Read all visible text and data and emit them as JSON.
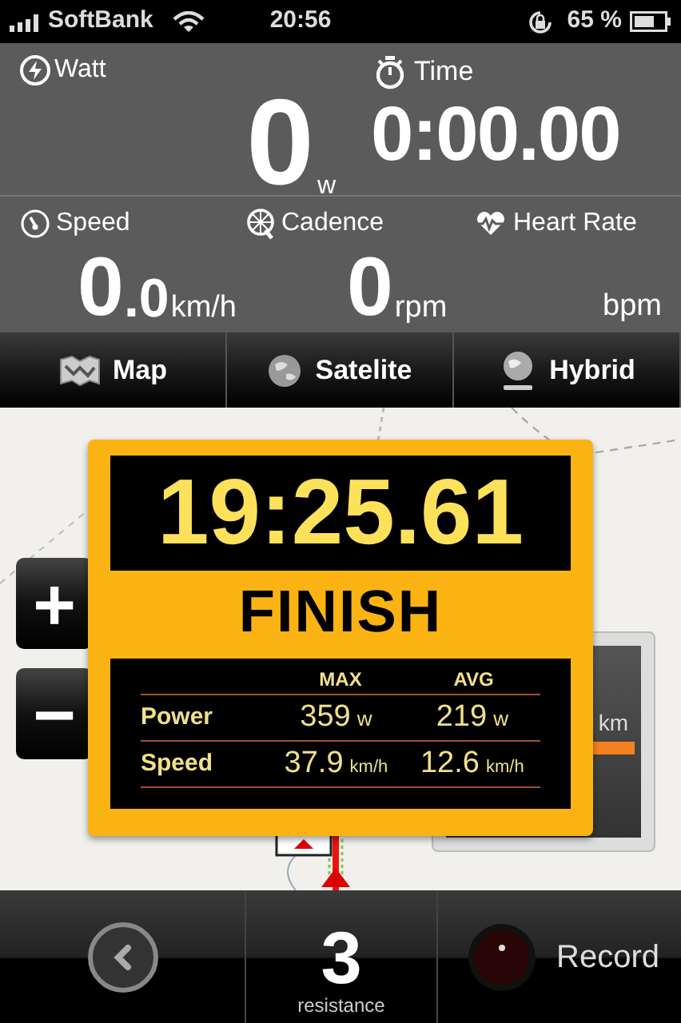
{
  "status_bar": {
    "carrier": "SoftBank",
    "time": "20:56",
    "battery": "65 %"
  },
  "metrics": {
    "watt": {
      "label": "Watt",
      "value": "0",
      "unit": "w"
    },
    "time": {
      "label": "Time",
      "value": "0:00.00"
    },
    "speed": {
      "label": "Speed",
      "value": "0",
      "fraction": ".0",
      "unit": "km/h"
    },
    "cadence": {
      "label": "Cadence",
      "value": "0",
      "unit": "rpm"
    },
    "heart_rate": {
      "label": "Heart Rate",
      "unit": "bpm"
    }
  },
  "map_tabs": [
    {
      "label": "Map",
      "kind": "map"
    },
    {
      "label": "Satelite",
      "kind": "satellite"
    },
    {
      "label": "Hybrid",
      "kind": "hybrid"
    }
  ],
  "zoom_buttons": [
    "+",
    "−"
  ],
  "distance_widget": {
    "unit": "km"
  },
  "finish_card": {
    "time": "19:25.61",
    "title": "FINISH",
    "columns": [
      "MAX",
      "AVG"
    ],
    "rows": [
      {
        "label": "Power",
        "max": "359",
        "max_unit": "w",
        "avg": "219",
        "avg_unit": "w"
      },
      {
        "label": "Speed",
        "max": "37.9",
        "max_unit": "km/h",
        "avg": "12.6",
        "avg_unit": "km/h"
      }
    ]
  },
  "bottom_bar": {
    "resistance": {
      "value": "3",
      "label": "resistance"
    },
    "record": "Record"
  }
}
